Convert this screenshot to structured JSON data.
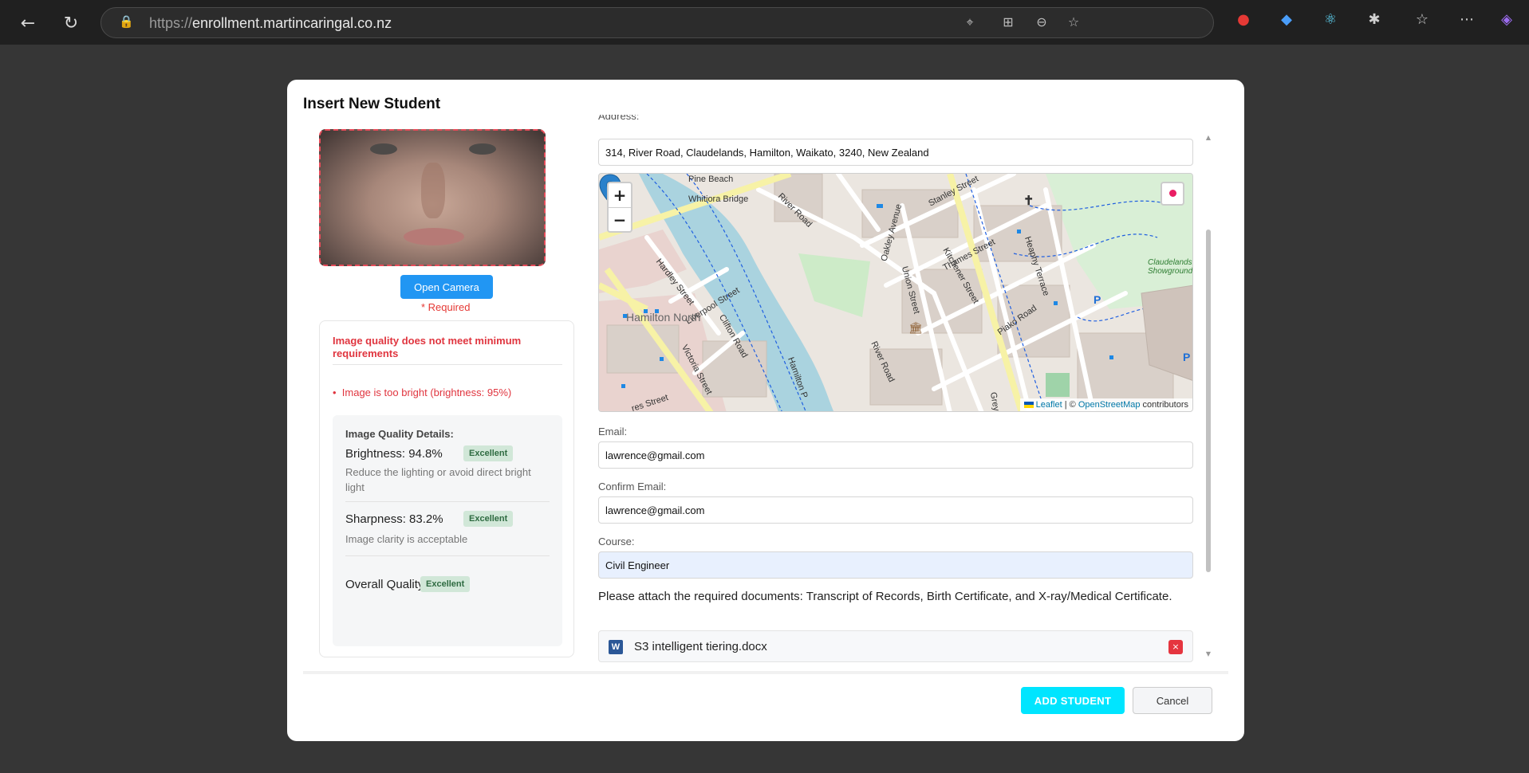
{
  "browser": {
    "url_protocol": "https://",
    "url_host": "enrollment.martincaringal.co.nz"
  },
  "modal": {
    "title": "Insert New Student",
    "open_camera_label": "Open Camera",
    "required_text": "* Required",
    "quality": {
      "error_title": "Image quality does not meet minimum requirements",
      "error_items": [
        "Image is too bright (brightness: 95%)"
      ],
      "details_title": "Image Quality Details:",
      "brightness": {
        "label": "Brightness: 94.8%",
        "badge": "Excellent",
        "hint": "Reduce the lighting or avoid direct bright light"
      },
      "sharpness": {
        "label": "Sharpness: 83.2%",
        "badge": "Excellent",
        "hint": "Image clarity is acceptable"
      },
      "overall": {
        "label": "Overall Quality:",
        "badge": "Excellent"
      }
    },
    "address_label": "Address:",
    "address_value": "314, River Road, Claudelands, Hamilton, Waikato, 3240, New Zealand",
    "map": {
      "zoom_in": "+",
      "zoom_out": "−",
      "attribution_leaflet": "Leaflet",
      "attribution_sep": " | © ",
      "attribution_osm": "OpenStreetMap",
      "attribution_suffix": " contributors",
      "labels": {
        "pine_beach": "Pine Beach",
        "whitiora_bridge": "Whitiora Bridge",
        "river_road": "River Road",
        "stanley_street": "Stanley Street",
        "oakley_avenue": "Oakley Avenue",
        "thames_street": "Thames Street",
        "heaphy_terrace": "Heaphy Terrace",
        "claudelands_showground": "Claudelands Showground",
        "hardley_street": "Hardley Street",
        "liverpool_street": "Liverpool Street",
        "hamilton_north": "Hamilton North",
        "clifton_road": "Clifton Road",
        "union_street": "Union Street",
        "kitchener_street": "Kitchener Street",
        "piako_road": "Piako Road",
        "river_road_2": "River Road",
        "victoria_street": "Victoria Street",
        "hamilton_path": "Hamilton P",
        "grey_street": "Grey",
        "res_street": "res Street"
      }
    },
    "email_label": "Email:",
    "email_value": "lawrence@gmail.com",
    "confirm_email_label": "Confirm Email:",
    "confirm_email_value": "lawrence@gmail.com",
    "course_label": "Course:",
    "course_value": "Civil Engineer",
    "attach_text": "Please attach the required documents: Transcript of Records, Birth Certificate, and X-ray/Medical Certificate.",
    "file_name": "S3 intelligent tiering.docx",
    "file_icon_letter": "W",
    "file_remove": "×",
    "add_student_label": "ADD STUDENT",
    "cancel_label": "Cancel"
  },
  "colors": {
    "accent_blue": "#2196f3",
    "error_red": "#e0353f",
    "add_button": "#00e5ff",
    "badge_green_bg": "#d1e7d8"
  }
}
